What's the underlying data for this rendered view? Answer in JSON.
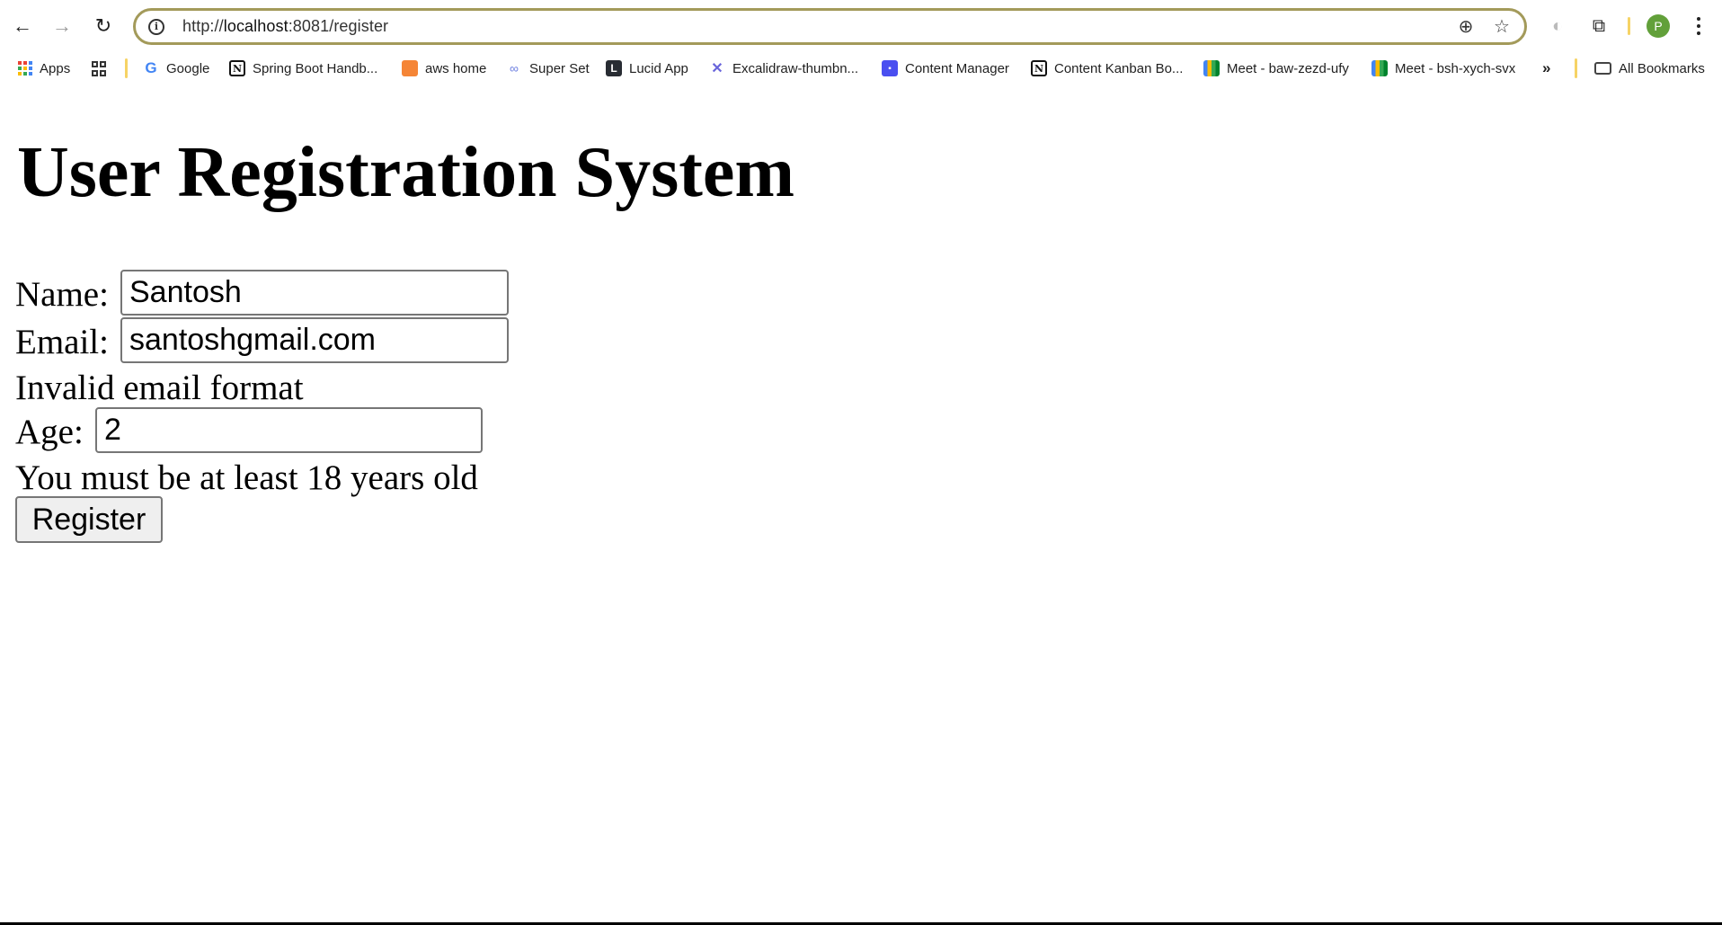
{
  "browser": {
    "url_prefix": "http://",
    "url_host": "localhost",
    "url_rest": ":8081/register",
    "nav": {
      "back_icon": "←",
      "forward_icon": "→",
      "reload_icon": "↻"
    },
    "omnibox_icons": {
      "info_icon": "i",
      "zoom_icon": "⊕",
      "star_icon": "☆"
    },
    "toolbar_icons": {
      "extension_icon": "◐",
      "puzzle_icon": "⧉"
    },
    "profile_initial": "P",
    "accent_color": "#a39a5a",
    "avatar_color": "#62a03a"
  },
  "bookmarks": {
    "items": [
      {
        "label": "Apps",
        "icon": "apps-icon"
      },
      {
        "label": "",
        "icon": "grid-icon"
      },
      {
        "label": "Google",
        "icon": "google-icon"
      },
      {
        "label": "Spring Boot Handb...",
        "icon": "notion-icon"
      },
      {
        "label": "aws home",
        "icon": "aws-icon"
      },
      {
        "label": "Super Set",
        "icon": "superset-icon"
      },
      {
        "label": "Lucid App",
        "icon": "lucid-icon"
      },
      {
        "label": "Excalidraw-thumbn...",
        "icon": "excalidraw-icon"
      },
      {
        "label": "Content Manager",
        "icon": "content-manager-icon"
      },
      {
        "label": "Content Kanban Bo...",
        "icon": "notion-icon"
      },
      {
        "label": "Meet - baw-zezd-ufy",
        "icon": "meet-icon"
      },
      {
        "label": "Meet - bsh-xych-svx",
        "icon": "meet-icon"
      }
    ],
    "overflow_icon": "»",
    "all_bookmarks_label": "All Bookmarks"
  },
  "page": {
    "title": "User Registration System",
    "form": {
      "name_label": "Name:",
      "name_value": "Santosh",
      "email_label": "Email:",
      "email_value": "santoshgmail.com",
      "email_error": "Invalid email format",
      "age_label": "Age:",
      "age_value": "2",
      "age_error": "You must be at least 18 years old",
      "submit_label": "Register"
    }
  }
}
